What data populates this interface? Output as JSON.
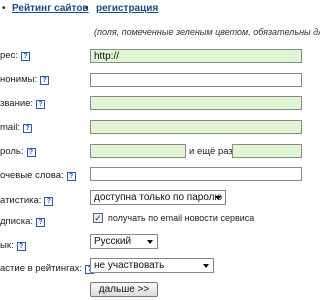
{
  "nav": {
    "sites_rating": "Рейтинг сайтов",
    "registration": "регистрация",
    "bullet": "•"
  },
  "note": "(поля, помеченные зеленым цветом, обязательны для",
  "help_glyph": "?",
  "fields": {
    "address": {
      "label": "рес:",
      "value": "http://"
    },
    "anonyms": {
      "label": "нонимы:"
    },
    "name": {
      "label": "звание:"
    },
    "email": {
      "label": "mail:"
    },
    "password": {
      "label": "роль:",
      "again_label": "и ещё раз:"
    },
    "keywords": {
      "label": "очевые слова:"
    },
    "statistics": {
      "label": "атистика:",
      "selected": "доступна только по паролю"
    },
    "subscription": {
      "label": "дписка:",
      "checkbox_label": "получать по email новости сервиса",
      "checked": true
    },
    "language": {
      "label": "ык:",
      "selected": "Русский"
    },
    "ratings": {
      "label": "астие в рейтингах:",
      "selected": "не участвовать"
    }
  },
  "submit_label": "дальше >>",
  "colors": {
    "required_field": "#dff5d3",
    "link": "#1a4a8a",
    "help_icon": "#2a5aa8"
  }
}
